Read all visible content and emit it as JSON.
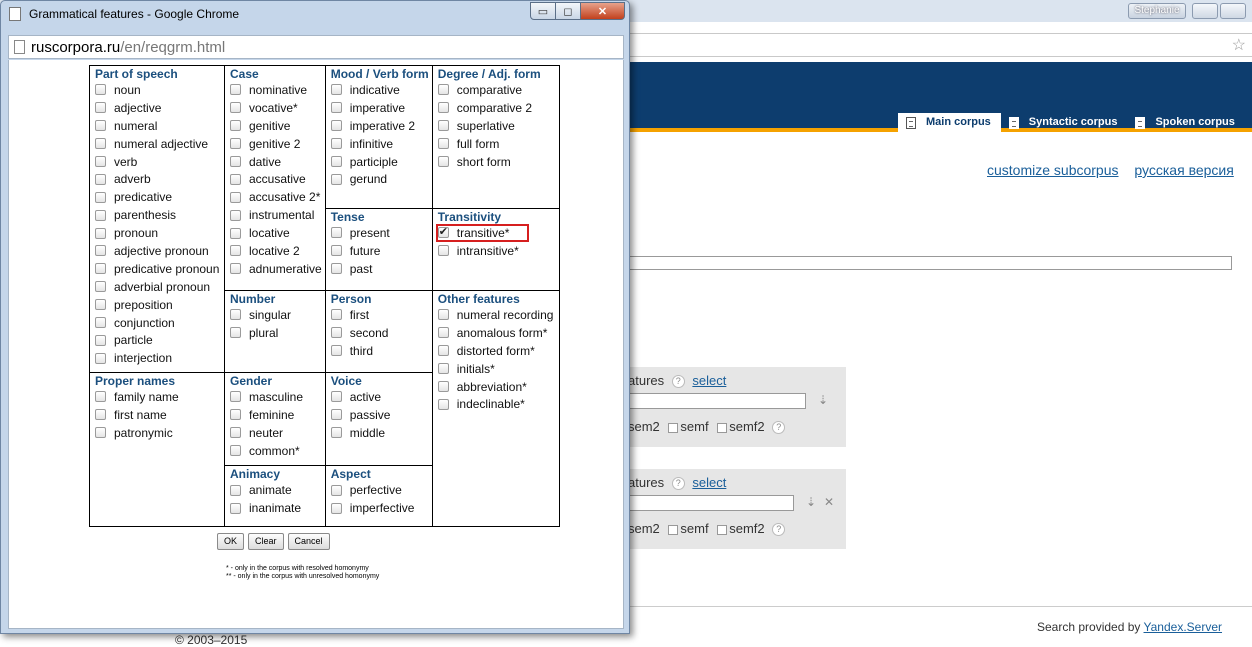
{
  "background": {
    "user_button": "Stephanie",
    "tabs": [
      {
        "label": "Main corpus",
        "active": true
      },
      {
        "label": "Syntactic corpus",
        "active": false
      },
      {
        "label": "Spoken corpus",
        "active": false
      }
    ],
    "links": {
      "customize": "customize subcorpus",
      "russian": "русская версия"
    },
    "panel1": {
      "features_label": "atures",
      "q": "?",
      "select_label": "select",
      "sem2": "sem2",
      "semf": "semf",
      "semf2": "semf2"
    },
    "panel2": {
      "features_label": "atures",
      "q": "?",
      "select_label": "select",
      "sem2": "sem2",
      "semf": "semf",
      "semf2": "semf2"
    },
    "footer": {
      "search_provided": "Search provided by ",
      "yandex": "Yandex.Server",
      "copyright": "© 2003–2015"
    }
  },
  "popup": {
    "title": "Grammatical features - Google Chrome",
    "url_host": "ruscorpora.ru",
    "url_path": "/en/reqgrm.html",
    "sections": {
      "part_of_speech": {
        "title": "Part of speech",
        "items": [
          "noun",
          "adjective",
          "numeral",
          "numeral adjective",
          "verb",
          "adverb",
          "predicative",
          "parenthesis",
          "pronoun",
          "adjective pronoun",
          "predicative pronoun",
          "adverbial pronoun",
          "preposition",
          "conjunction",
          "particle",
          "interjection"
        ]
      },
      "proper_names": {
        "title": "Proper names",
        "items": [
          "family name",
          "first name",
          "patronymic"
        ]
      },
      "case": {
        "title": "Case",
        "items": [
          "nominative",
          "vocative*",
          "genitive",
          "genitive 2",
          "dative",
          "accusative",
          "accusative 2*",
          "instrumental",
          "locative",
          "locative 2",
          "adnumerative"
        ]
      },
      "number": {
        "title": "Number",
        "items": [
          "singular",
          "plural"
        ]
      },
      "gender": {
        "title": "Gender",
        "items": [
          "masculine",
          "feminine",
          "neuter",
          "common*"
        ]
      },
      "animacy": {
        "title": "Animacy",
        "items": [
          "animate",
          "inanimate"
        ]
      },
      "mood": {
        "title": "Mood / Verb form",
        "items": [
          "indicative",
          "imperative",
          "imperative 2",
          "infinitive",
          "participle",
          "gerund"
        ]
      },
      "tense": {
        "title": "Tense",
        "items": [
          "present",
          "future",
          "past"
        ]
      },
      "person": {
        "title": "Person",
        "items": [
          "first",
          "second",
          "third"
        ]
      },
      "voice": {
        "title": "Voice",
        "items": [
          "active",
          "passive",
          "middle"
        ]
      },
      "aspect": {
        "title": "Aspect",
        "items": [
          "perfective",
          "imperfective"
        ]
      },
      "degree": {
        "title": "Degree / Adj. form",
        "items": [
          "comparative",
          "comparative 2",
          "superlative",
          "full form",
          "short form"
        ]
      },
      "transitivity": {
        "title": "Transitivity",
        "items": [
          "transitive*",
          "intransitive*"
        ],
        "checked": "transitive*"
      },
      "other": {
        "title": "Other features",
        "items": [
          "numeral recording",
          "anomalous form*",
          "distorted form*",
          "initials*",
          "abbreviation*",
          "indeclinable*"
        ]
      }
    },
    "buttons": {
      "ok": "OK",
      "clear": "Clear",
      "cancel": "Cancel"
    },
    "notes": [
      "* - only in the corpus with resolved homonymy",
      "** - only in the corpus with unresolved homonymy"
    ]
  }
}
